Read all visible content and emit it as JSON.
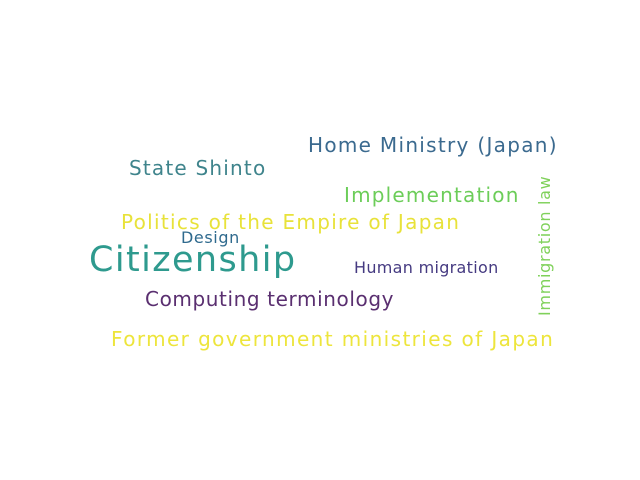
{
  "wordcloud": {
    "words": [
      {
        "text": "Home Ministry (Japan)",
        "color": "#3b6a8f"
      },
      {
        "text": "State Shinto",
        "color": "#3f848c"
      },
      {
        "text": "Implementation",
        "color": "#6ccd59"
      },
      {
        "text": "Politics of the Empire of Japan",
        "color": "#e8e23a"
      },
      {
        "text": "Design",
        "color": "#2f6a8e"
      },
      {
        "text": "Citizenship",
        "color": "#2e9a8e"
      },
      {
        "text": "Human migration",
        "color": "#453a81"
      },
      {
        "text": "Computing terminology",
        "color": "#5a2f70"
      },
      {
        "text": "Former government ministries of Japan",
        "color": "#ede53c"
      },
      {
        "text": "Immigration law",
        "color": "#7fd15a"
      }
    ]
  }
}
